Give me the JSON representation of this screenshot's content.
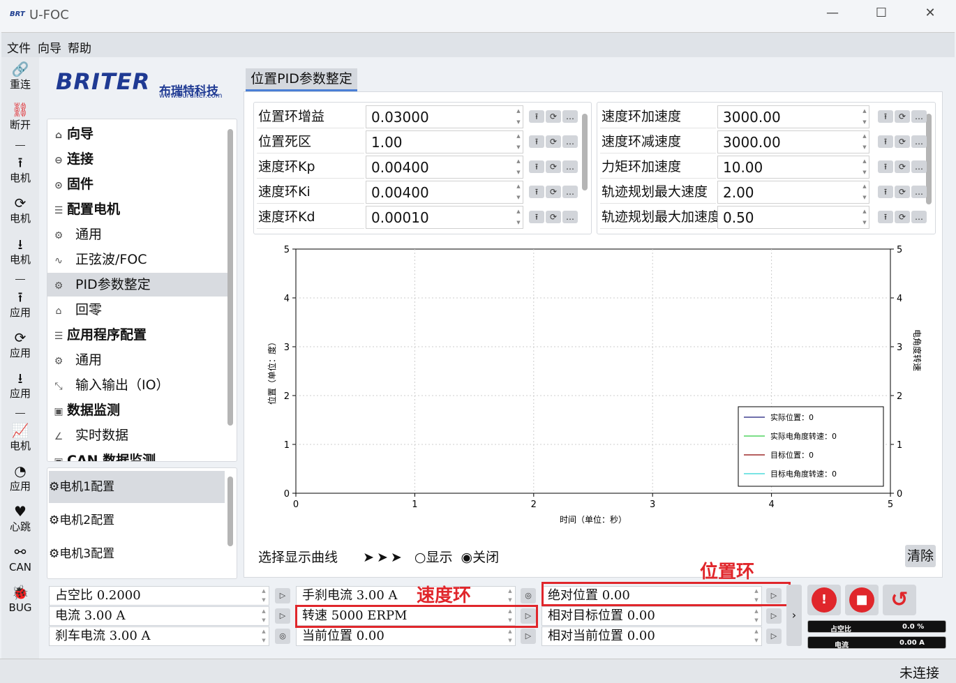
{
  "window": {
    "logo": "BRT",
    "title": "U-FOC",
    "min": "—",
    "max": "☐",
    "close": "✕"
  },
  "menu": [
    "文件",
    "向导",
    "帮助"
  ],
  "sidebar": [
    {
      "icon": "link-icon",
      "glyph": "🔗",
      "label": "重连",
      "color": "#2ecc40"
    },
    {
      "icon": "unlink-icon",
      "glyph": "⛓",
      "label": "断开",
      "color": "#e0262b"
    },
    {
      "icon": "upload-icon",
      "glyph": "⭱",
      "label": "电机"
    },
    {
      "icon": "refresh-icon",
      "glyph": "⟳",
      "label": "电机"
    },
    {
      "icon": "download-icon",
      "glyph": "⭳",
      "label": "电机"
    },
    {
      "icon": "upload-icon",
      "glyph": "⭱",
      "label": "应用"
    },
    {
      "icon": "refresh-icon",
      "glyph": "⟳",
      "label": "应用"
    },
    {
      "icon": "download-icon",
      "glyph": "⭳",
      "label": "应用"
    },
    {
      "icon": "chart-icon",
      "glyph": "📈",
      "label": "电机"
    },
    {
      "icon": "gauge-icon",
      "glyph": "◔",
      "label": "应用"
    },
    {
      "icon": "heartbeat-icon",
      "glyph": "♥",
      "label": "心跳"
    },
    {
      "icon": "network-icon",
      "glyph": "⚯",
      "label": "CAN"
    },
    {
      "icon": "bug-icon",
      "glyph": "🐞",
      "label": "BUG"
    }
  ],
  "brand": {
    "name": "BRITER",
    "cn": "布瑞特科技",
    "url": "www.buruiter.com"
  },
  "nav": [
    {
      "label": "向导",
      "glyph": "⌂",
      "head": true
    },
    {
      "label": "连接",
      "glyph": "⊖",
      "head": true
    },
    {
      "label": "固件",
      "glyph": "⊙",
      "head": true
    },
    {
      "label": "配置电机",
      "glyph": "☰",
      "head": true
    },
    {
      "label": "通用",
      "glyph": "⚙",
      "head": false
    },
    {
      "label": "正弦波/FOC",
      "glyph": "∿",
      "head": false
    },
    {
      "label": "PID参数整定",
      "glyph": "⚙",
      "head": false,
      "selected": true
    },
    {
      "label": "回零",
      "glyph": "⌂",
      "head": false
    },
    {
      "label": "应用程序配置",
      "glyph": "☰",
      "head": true
    },
    {
      "label": "通用",
      "glyph": "⚙",
      "head": false
    },
    {
      "label": "输入输出（IO）",
      "glyph": "⤡",
      "head": false
    },
    {
      "label": "数据监测",
      "glyph": "▣",
      "head": true
    },
    {
      "label": "实时数据",
      "glyph": "∠",
      "head": false
    },
    {
      "label": "CAN 数据监测",
      "glyph": "▣",
      "head": true
    }
  ],
  "motors": [
    "电机1配置",
    "电机2配置",
    "电机3配置"
  ],
  "tab": "位置PID参数整定",
  "params_left": [
    {
      "label": "位置环增益",
      "value": "0.03000"
    },
    {
      "label": "位置死区",
      "value": "1.00"
    },
    {
      "label": "速度环Kp",
      "value": "0.00400"
    },
    {
      "label": "速度环Ki",
      "value": "0.00400"
    },
    {
      "label": "速度环Kd",
      "value": "0.00010"
    }
  ],
  "params_right": [
    {
      "label": "速度环加速度",
      "value": "3000.00"
    },
    {
      "label": "速度环减速度",
      "value": "3000.00"
    },
    {
      "label": "力矩环加速度",
      "value": "10.00"
    },
    {
      "label": "轨迹规划最大速度",
      "value": "2.00"
    },
    {
      "label": "轨迹规划最大加速度",
      "value": "0.50"
    }
  ],
  "chart_data": {
    "type": "line",
    "xlabel": "时间（单位：秒）",
    "ylabel": "位置（单位：度）",
    "y2label": "电角度转速",
    "xlim": [
      0,
      5
    ],
    "ylim": [
      0,
      5
    ],
    "y2lim": [
      0,
      5
    ],
    "xticks": [
      "0",
      "1",
      "2",
      "3",
      "4",
      "5"
    ],
    "yticks": [
      "0",
      "1",
      "2",
      "3",
      "4",
      "5"
    ],
    "grid": true,
    "legend_position": "bottom-right",
    "series": [
      {
        "name": "实际位置：0",
        "color": "#1a1a7a",
        "values": []
      },
      {
        "name": "实际电角度转速：0",
        "color": "#2ecc40",
        "values": []
      },
      {
        "name": "目标位置：0",
        "color": "#8b0000",
        "values": []
      },
      {
        "name": "目标电角度转速：0",
        "color": "#2ad4d4",
        "values": []
      }
    ]
  },
  "curve_select": {
    "label": "选择显示曲线",
    "show": "显示",
    "hide": "关闭",
    "clear": "清除"
  },
  "bottom": {
    "col1": [
      "占空比  0.2000",
      "电流  3.00  A",
      "刹车电流  3.00  A"
    ],
    "col2": [
      "手刹电流  3.00  A",
      "转速  5000  ERPM",
      "当前位置  0.00"
    ],
    "col3": [
      "绝对位置  0.00",
      "相对目标位置  0.00",
      "相对当前位置  0.00"
    ]
  },
  "annotations": {
    "speed": "速度环",
    "position": "位置环"
  },
  "meters": [
    {
      "label": "占空比",
      "value": "0.0 %"
    },
    {
      "label": "电流",
      "value": "0.00 A"
    }
  ],
  "status": "未连接"
}
